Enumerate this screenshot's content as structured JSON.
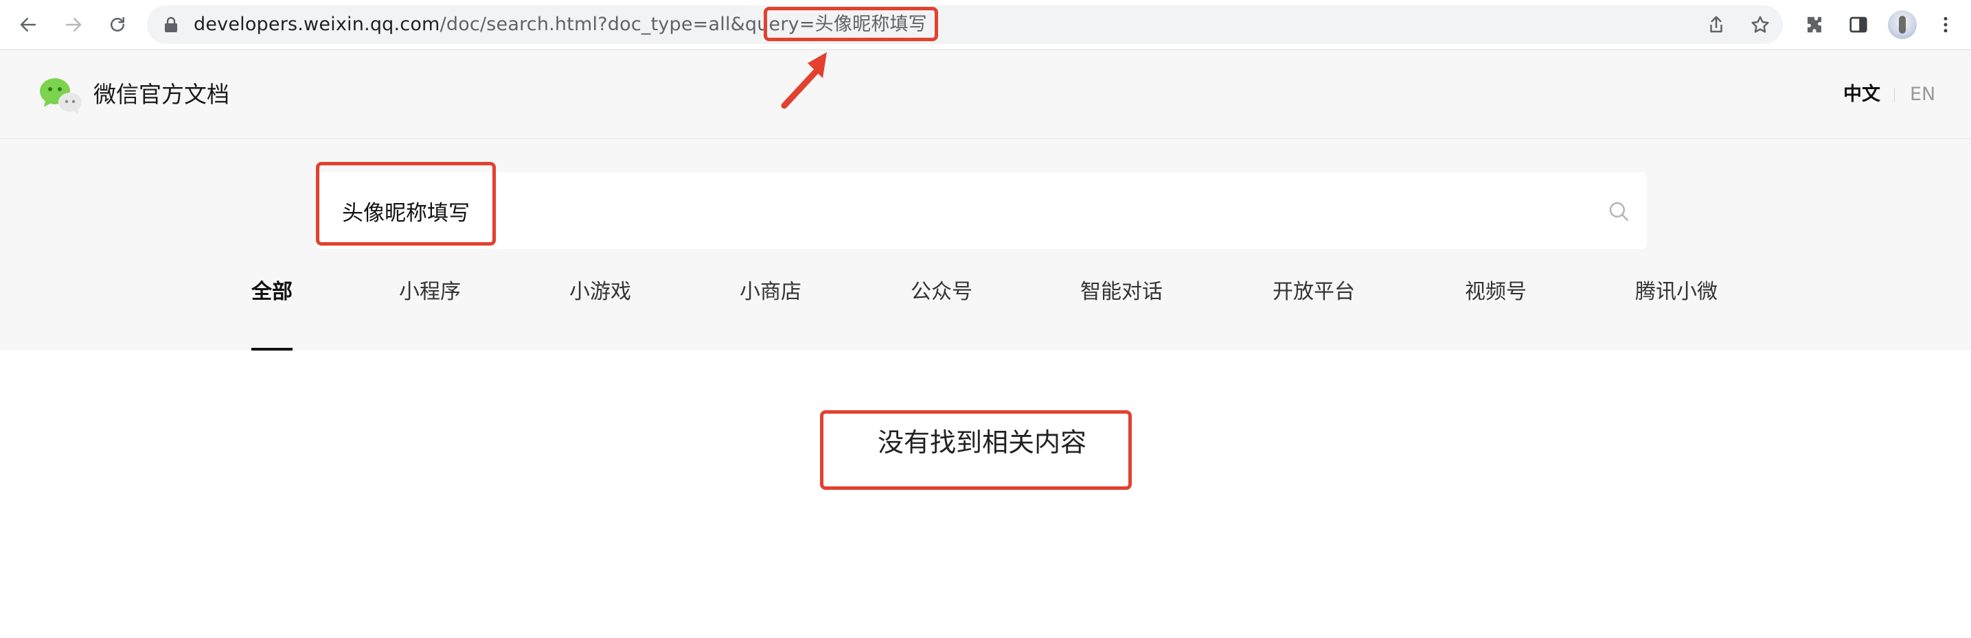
{
  "browser": {
    "url_host": "developers.weixin.qq.com",
    "url_rest": "/doc/search.html?doc_type=all&query=头像昵称填写"
  },
  "header": {
    "site_title": "微信官方文档",
    "lang_zh": "中文",
    "lang_en": "EN"
  },
  "search": {
    "value": "头像昵称填写"
  },
  "tabs": [
    {
      "label": "全部",
      "active": true
    },
    {
      "label": "小程序"
    },
    {
      "label": "小游戏"
    },
    {
      "label": "小商店"
    },
    {
      "label": "公众号"
    },
    {
      "label": "智能对话"
    },
    {
      "label": "开放平台"
    },
    {
      "label": "视频号"
    },
    {
      "label": "腾讯小微"
    }
  ],
  "results": {
    "empty_message": "没有找到相关内容"
  },
  "colors": {
    "annotation": "#e2412f",
    "logo_green": "#7cd34e",
    "header_bg": "#f7f7f7"
  }
}
